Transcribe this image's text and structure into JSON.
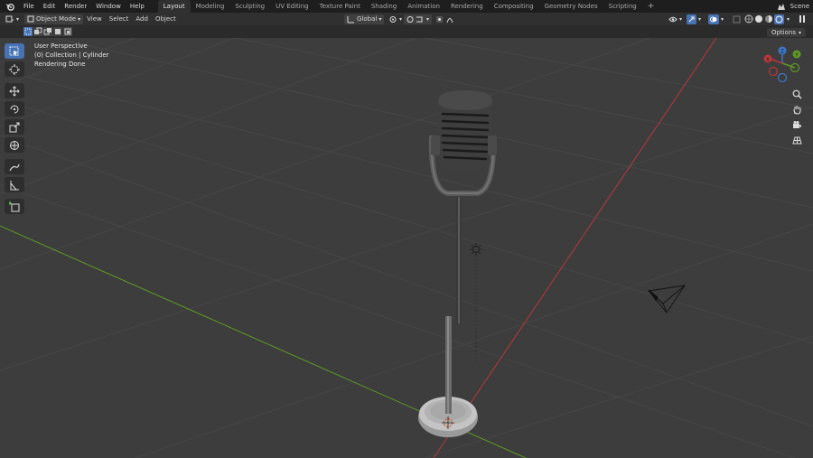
{
  "topbar": {
    "menu": [
      "File",
      "Edit",
      "Render",
      "Window",
      "Help"
    ],
    "workspaces": [
      "Layout",
      "Modeling",
      "Sculpting",
      "UV Editing",
      "Texture Paint",
      "Shading",
      "Animation",
      "Rendering",
      "Compositing",
      "Geometry Nodes",
      "Scripting"
    ],
    "active_workspace": "Layout",
    "scene_label": "Scene"
  },
  "header": {
    "mode": "Object Mode",
    "menus": [
      "View",
      "Select",
      "Add",
      "Object"
    ],
    "transform_orientation": "Global"
  },
  "viewport": {
    "info_lines": [
      "User Perspective",
      "(0) Collection | Cylinder",
      "Rendering Done"
    ],
    "options_label": "Options",
    "gizmo_axes": [
      "X",
      "Y",
      "Z"
    ]
  },
  "colors": {
    "accent": "#4772b3",
    "x_axis": "#b8383d",
    "y_axis": "#5e9a25",
    "z_axis": "#3c78c8",
    "viewport_bg": "#3d3d3d",
    "grid": "#474747"
  },
  "icons": {
    "tools": [
      "select-box-icon",
      "cursor-icon",
      "move-icon",
      "rotate-icon",
      "scale-icon",
      "transform-icon",
      "annotate-icon",
      "measure-icon",
      "add-cube-icon"
    ],
    "nav": [
      "zoom-icon",
      "hand-pan-icon",
      "camera-view-icon",
      "grid-view-icon"
    ]
  }
}
